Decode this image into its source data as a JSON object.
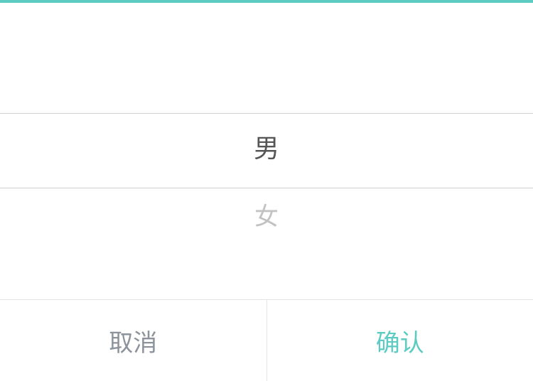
{
  "picker": {
    "options": [
      "男",
      "女"
    ],
    "selected_index": 0
  },
  "footer": {
    "cancel_label": "取消",
    "confirm_label": "确认"
  },
  "colors": {
    "accent": "#5ccbc2",
    "cancel_text": "#8c939b",
    "selected_text": "#555555",
    "unselected_text": "#c2c2c2"
  }
}
